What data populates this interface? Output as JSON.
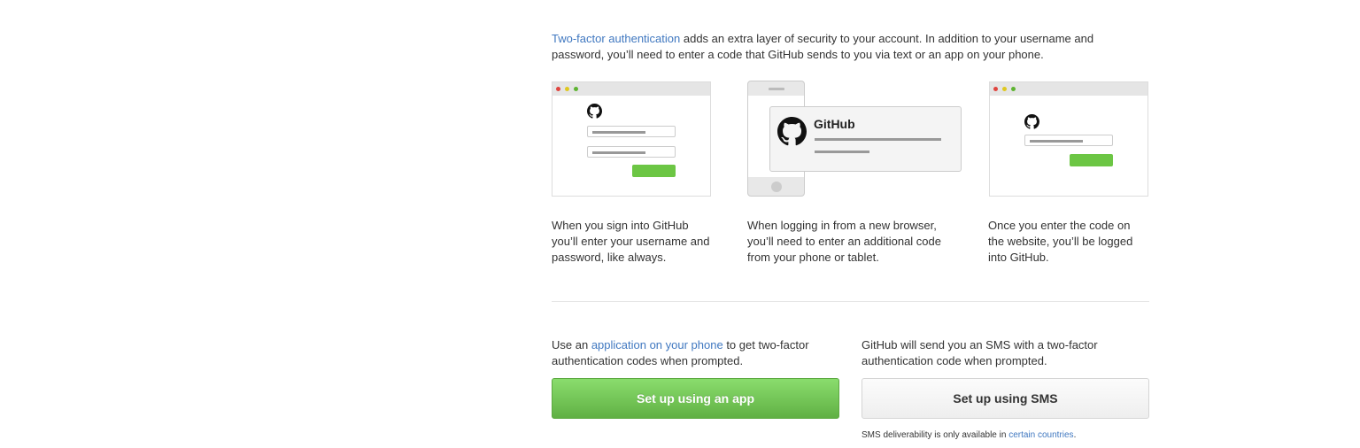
{
  "intro": {
    "link_text": "Two-factor authentication",
    "text": " adds an extra layer of security to your account. In addition to your username and password, you’ll need to enter a code that GitHub sends to you via text or an app on your phone."
  },
  "illustrations": {
    "notification_title": "GitHub"
  },
  "steps": [
    {
      "text": "When you sign into GitHub you’ll enter your username and password, like always."
    },
    {
      "text": "When logging in from a new browser, you’ll need to enter an additional code from your phone or tablet."
    },
    {
      "text": "Once you enter the code on the website, you’ll be logged into GitHub."
    }
  ],
  "app_option": {
    "prefix": "Use an ",
    "link_text": "application on your phone",
    "suffix": " to get two-factor authentication codes when prompted.",
    "button_label": "Set up using an app"
  },
  "sms_option": {
    "text": "GitHub will send you an SMS with a two-factor authentication code when prompted.",
    "button_label": "Set up using SMS",
    "note_prefix": "SMS deliverability is only available in ",
    "note_link": "certain countries",
    "note_suffix": "."
  },
  "colors": {
    "link": "#4078c0",
    "primary_button": "#6cc644",
    "text": "#333333"
  },
  "icons": [
    "github-octocat-icon"
  ]
}
